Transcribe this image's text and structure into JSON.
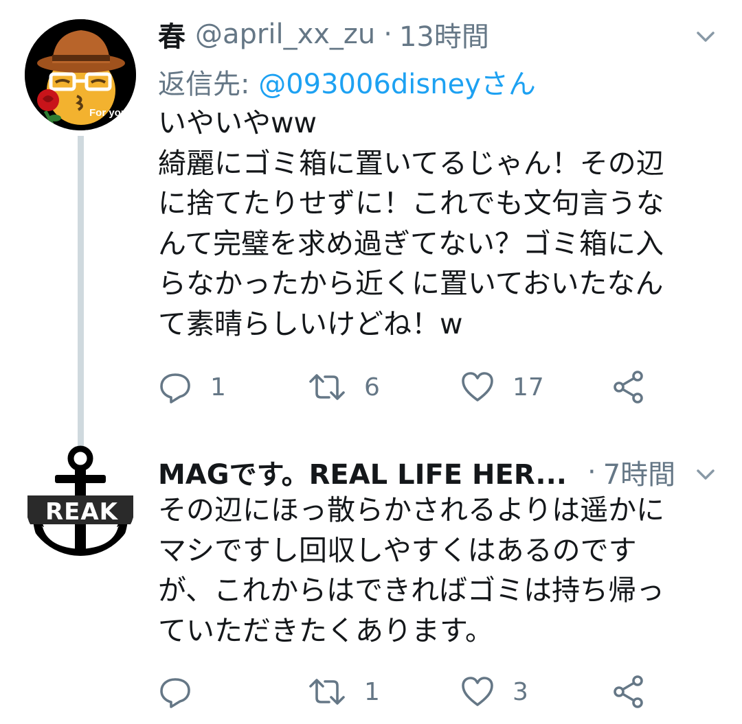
{
  "tweets": [
    {
      "display_name": "春",
      "handle": "@april_xx_zu",
      "separator": "·",
      "time": "13時間",
      "reply_prefix": "返信先: ",
      "reply_target": "@093006disneyさん",
      "avatar_caption": "For you.",
      "body": "いやいやww\n綺麗にゴミ箱に置いてるじゃん！その辺\nに捨てたりせずに！これでも文句言うな\nんて完璧を求め過ぎてない？ゴミ箱に入\nらなかったから近くに置いておいたなん\nて素晴らしいけどね！w",
      "replies": "1",
      "retweets": "6",
      "likes": "17"
    },
    {
      "display_name": "MAGです。REAL LIFE  HER...",
      "separator": "·",
      "time": "7時間",
      "avatar_text": "REAK",
      "body": "その辺にほっ散らかされるよりは遥かに\nマシですし回収しやすくはあるのです\nが、これからはできればゴミは持ち帰っ\nていただきたくあります。",
      "replies": "",
      "retweets": "1",
      "likes": "3"
    }
  ],
  "icons": {
    "reply": "reply-icon",
    "retweet": "retweet-icon",
    "like": "heart-icon",
    "share": "share-icon",
    "menu": "chevron-down-icon"
  },
  "colors": {
    "text": "#14171a",
    "secondary": "#657786",
    "link": "#1da1f2",
    "thread_line": "#cfd9de"
  }
}
